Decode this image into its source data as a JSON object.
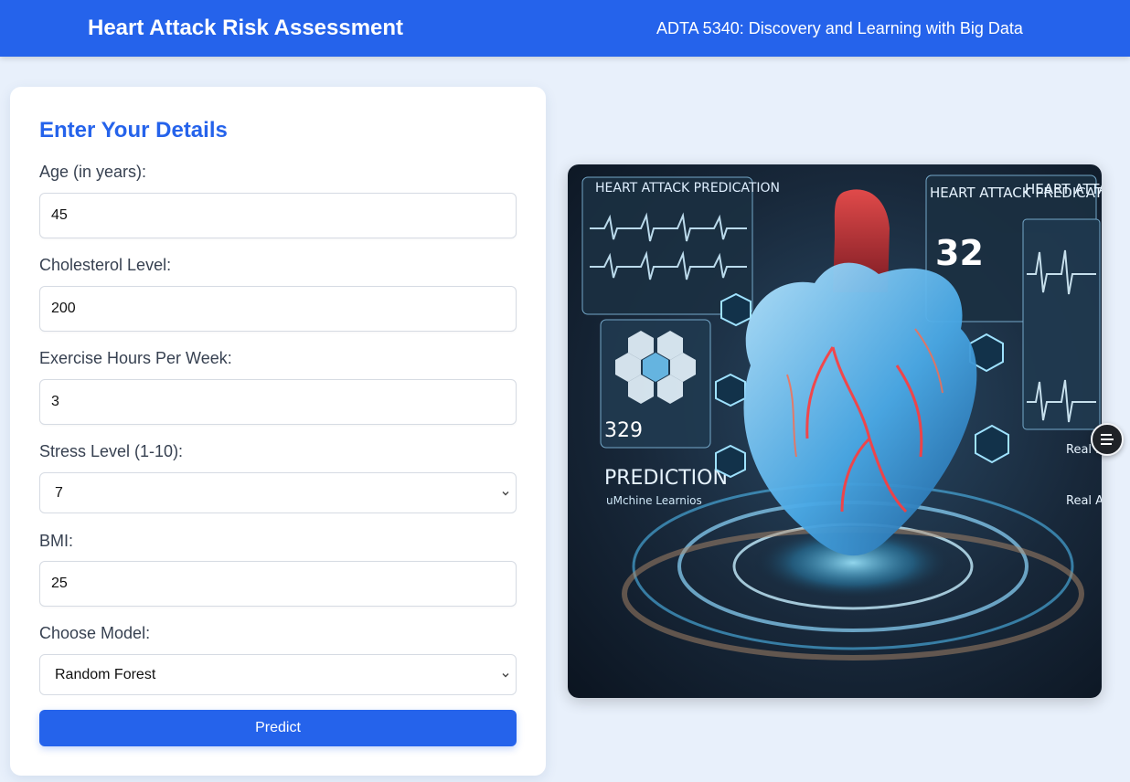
{
  "header": {
    "title": "Heart Attack Risk Assessment",
    "course": "ADTA 5340: Discovery and Learning with Big Data"
  },
  "form": {
    "heading": "Enter Your Details",
    "age": {
      "label": "Age (in years):",
      "value": "45"
    },
    "cholesterol": {
      "label": "Cholesterol Level:",
      "value": "200"
    },
    "exercise": {
      "label": "Exercise Hours Per Week:",
      "value": "3"
    },
    "stress": {
      "label": "Stress Level (1-10):",
      "value": "7"
    },
    "bmi": {
      "label": "BMI:",
      "value": "25"
    },
    "model": {
      "label": "Choose Model:",
      "value": "Random Forest"
    },
    "predict_label": "Predict"
  },
  "hero": {
    "panel_title_1": "HEART ATTACK PREDICATION",
    "panel_title_2": "HEART ATTACK PREDICATION",
    "panel_title_3": "HEART ATTA",
    "number_big": "32",
    "number_small": "329",
    "prediction_label": "PREDICTION",
    "ml_label": "uMchine Learnios",
    "real_1": "Real netwo",
    "real_2": "Real Analy"
  },
  "icons": {
    "floating_button": "menu-lines-icon",
    "select_chevron": "chevron-down-icon"
  },
  "colors": {
    "primary": "#2563eb",
    "background": "#e8f0fb",
    "card": "#ffffff"
  }
}
